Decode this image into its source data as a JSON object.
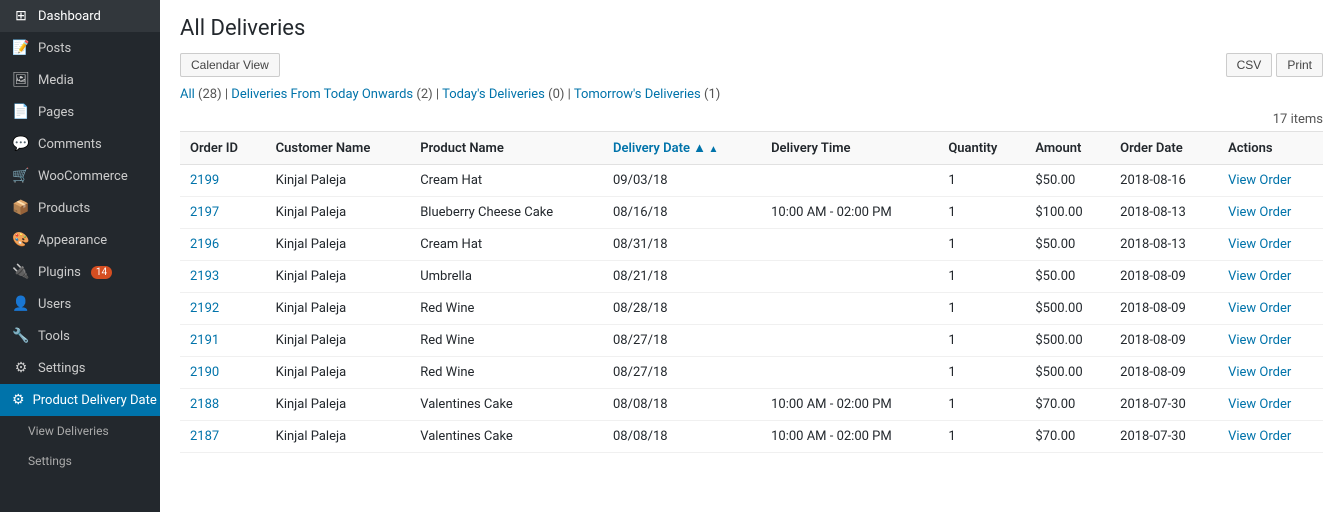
{
  "sidebar": {
    "items": [
      {
        "id": "dashboard",
        "label": "Dashboard",
        "icon": "⊞",
        "active": false
      },
      {
        "id": "posts",
        "label": "Posts",
        "icon": "📝",
        "active": false
      },
      {
        "id": "media",
        "label": "Media",
        "icon": "🖼",
        "active": false
      },
      {
        "id": "pages",
        "label": "Pages",
        "icon": "📄",
        "active": false
      },
      {
        "id": "comments",
        "label": "Comments",
        "icon": "💬",
        "active": false
      },
      {
        "id": "woocommerce",
        "label": "WooCommerce",
        "icon": "🛒",
        "active": false
      },
      {
        "id": "products",
        "label": "Products",
        "icon": "📦",
        "active": false
      },
      {
        "id": "appearance",
        "label": "Appearance",
        "icon": "🎨",
        "active": false
      },
      {
        "id": "plugins",
        "label": "Plugins",
        "icon": "🔌",
        "badge": "14",
        "active": false
      },
      {
        "id": "users",
        "label": "Users",
        "icon": "👤",
        "active": false
      },
      {
        "id": "tools",
        "label": "Tools",
        "icon": "🔧",
        "active": false
      },
      {
        "id": "settings",
        "label": "Settings",
        "icon": "⚙",
        "active": false
      },
      {
        "id": "product-delivery-date",
        "label": "Product Delivery Date",
        "icon": "⚙",
        "active": true
      },
      {
        "id": "view-deliveries",
        "label": "View Deliveries",
        "icon": "",
        "active": false,
        "submenu": true
      },
      {
        "id": "sub-settings",
        "label": "Settings",
        "icon": "",
        "active": false,
        "submenu": true
      }
    ]
  },
  "page": {
    "title": "All Deliveries"
  },
  "toolbar": {
    "calendar_view_label": "Calendar View",
    "csv_label": "CSV",
    "print_label": "Print"
  },
  "filters": {
    "all_label": "All",
    "all_count": "28",
    "deliveries_from_today_label": "Deliveries From Today Onwards",
    "deliveries_from_today_count": "2",
    "todays_deliveries_label": "Today's Deliveries",
    "todays_deliveries_count": "0",
    "tomorrows_deliveries_label": "Tomorrow's Deliveries",
    "tomorrows_deliveries_count": "1"
  },
  "items_count": "17 items",
  "table": {
    "columns": [
      {
        "id": "order-id",
        "label": "Order ID",
        "sorted": false
      },
      {
        "id": "customer-name",
        "label": "Customer Name",
        "sorted": false
      },
      {
        "id": "product-name",
        "label": "Product Name",
        "sorted": false
      },
      {
        "id": "delivery-date",
        "label": "Delivery Date",
        "sorted": true
      },
      {
        "id": "delivery-time",
        "label": "Delivery Time",
        "sorted": false
      },
      {
        "id": "quantity",
        "label": "Quantity",
        "sorted": false
      },
      {
        "id": "amount",
        "label": "Amount",
        "sorted": false
      },
      {
        "id": "order-date",
        "label": "Order Date",
        "sorted": false
      },
      {
        "id": "actions",
        "label": "Actions",
        "sorted": false
      }
    ],
    "rows": [
      {
        "order_id": "2199",
        "customer_name": "Kinjal Paleja",
        "product_name": "Cream Hat",
        "delivery_date": "09/03/18",
        "delivery_time": "",
        "quantity": "1",
        "amount": "$50.00",
        "order_date": "2018-08-16",
        "action": "View Order"
      },
      {
        "order_id": "2197",
        "customer_name": "Kinjal Paleja",
        "product_name": "Blueberry Cheese Cake",
        "delivery_date": "08/16/18",
        "delivery_time": "10:00 AM - 02:00 PM",
        "quantity": "1",
        "amount": "$100.00",
        "order_date": "2018-08-13",
        "action": "View Order"
      },
      {
        "order_id": "2196",
        "customer_name": "Kinjal Paleja",
        "product_name": "Cream Hat",
        "delivery_date": "08/31/18",
        "delivery_time": "",
        "quantity": "1",
        "amount": "$50.00",
        "order_date": "2018-08-13",
        "action": "View Order"
      },
      {
        "order_id": "2193",
        "customer_name": "Kinjal Paleja",
        "product_name": "Umbrella",
        "delivery_date": "08/21/18",
        "delivery_time": "",
        "quantity": "1",
        "amount": "$50.00",
        "order_date": "2018-08-09",
        "action": "View Order"
      },
      {
        "order_id": "2192",
        "customer_name": "Kinjal Paleja",
        "product_name": "Red Wine",
        "delivery_date": "08/28/18",
        "delivery_time": "",
        "quantity": "1",
        "amount": "$500.00",
        "order_date": "2018-08-09",
        "action": "View Order"
      },
      {
        "order_id": "2191",
        "customer_name": "Kinjal Paleja",
        "product_name": "Red Wine",
        "delivery_date": "08/27/18",
        "delivery_time": "",
        "quantity": "1",
        "amount": "$500.00",
        "order_date": "2018-08-09",
        "action": "View Order"
      },
      {
        "order_id": "2190",
        "customer_name": "Kinjal Paleja",
        "product_name": "Red Wine",
        "delivery_date": "08/27/18",
        "delivery_time": "",
        "quantity": "1",
        "amount": "$500.00",
        "order_date": "2018-08-09",
        "action": "View Order"
      },
      {
        "order_id": "2188",
        "customer_name": "Kinjal Paleja",
        "product_name": "Valentines Cake",
        "delivery_date": "08/08/18",
        "delivery_time": "10:00 AM - 02:00 PM",
        "quantity": "1",
        "amount": "$70.00",
        "order_date": "2018-07-30",
        "action": "View Order"
      },
      {
        "order_id": "2187",
        "customer_name": "Kinjal Paleja",
        "product_name": "Valentines Cake",
        "delivery_date": "08/08/18",
        "delivery_time": "10:00 AM - 02:00 PM",
        "quantity": "1",
        "amount": "$70.00",
        "order_date": "2018-07-30",
        "action": "View Order"
      }
    ]
  }
}
